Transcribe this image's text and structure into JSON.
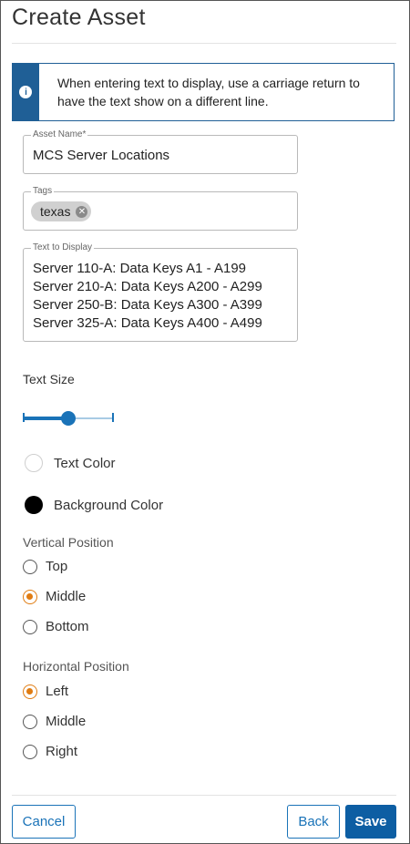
{
  "header": {
    "title": "Create Asset"
  },
  "info_banner": {
    "icon": "info-icon",
    "text": "When entering text to display, use a carriage return to have the text show on a different line."
  },
  "form": {
    "asset_name": {
      "label": "Asset Name*",
      "value": "MCS Server Locations"
    },
    "tags": {
      "label": "Tags",
      "chips": [
        {
          "label": "texas"
        }
      ]
    },
    "text_to_display": {
      "label": "Text to Display",
      "lines": [
        "Server 110-A: Data Keys A1 - A199",
        "Server 210-A: Data Keys A200 - A299",
        "Server 250-B: Data Keys A300 - A399",
        "Server 325-A: Data Keys A400 - A499"
      ]
    },
    "text_size": {
      "label": "Text Size",
      "level": 0.5
    },
    "text_color": {
      "label": "Text Color",
      "color": "#ffffff"
    },
    "background_color": {
      "label": "Background Color",
      "color": "#000000"
    },
    "vertical_position": {
      "label": "Vertical Position",
      "options": [
        {
          "label": "Top",
          "checked": false
        },
        {
          "label": "Middle",
          "checked": true
        },
        {
          "label": "Bottom",
          "checked": false
        }
      ]
    },
    "horizontal_position": {
      "label": "Horizontal Position",
      "options": [
        {
          "label": "Left",
          "checked": true
        },
        {
          "label": "Middle",
          "checked": false
        },
        {
          "label": "Right",
          "checked": false
        }
      ]
    }
  },
  "footer": {
    "cancel_label": "Cancel",
    "back_label": "Back",
    "save_label": "Save"
  },
  "colors": {
    "primary": "#0d5ea3",
    "info_banner": "#1f5f96",
    "radio_selected": "#e07c12"
  }
}
